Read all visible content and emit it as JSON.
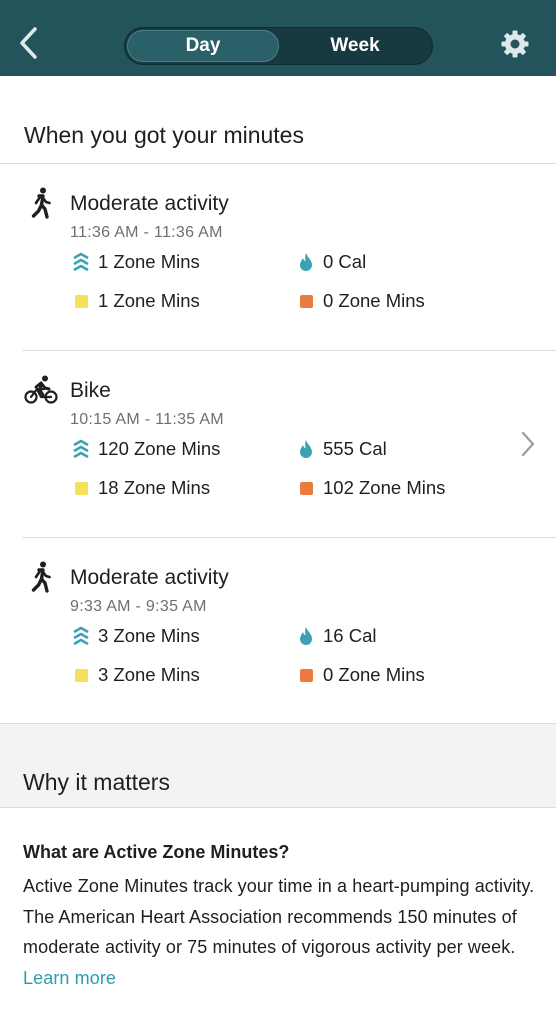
{
  "header": {
    "tabs": [
      {
        "label": "Day",
        "selected": true
      },
      {
        "label": "Week",
        "selected": false
      }
    ],
    "back_icon": "chevron-left-icon",
    "settings_icon": "gear-icon"
  },
  "minutes_section": {
    "title": "When you got your minutes"
  },
  "activities": [
    {
      "icon": "walking-icon",
      "title": "Moderate activity",
      "time": "11:36 AM - 11:36 AM",
      "zone_mins": "1 Zone Mins",
      "calories": "0 Cal",
      "fat_burn_mins": "1 Zone Mins",
      "cardio_mins": "0 Zone Mins"
    },
    {
      "icon": "bike-icon",
      "title": "Bike",
      "time": "10:15 AM - 11:35 AM",
      "zone_mins": "120 Zone Mins",
      "calories": "555 Cal",
      "fat_burn_mins": "18 Zone Mins",
      "cardio_mins": "102 Zone Mins"
    },
    {
      "icon": "walking-icon",
      "title": "Moderate activity",
      "time": "9:33 AM - 9:35 AM",
      "zone_mins": "3 Zone Mins",
      "calories": "16 Cal",
      "fat_burn_mins": "3 Zone Mins",
      "cardio_mins": "0 Zone Mins"
    }
  ],
  "why_section": {
    "title": "Why it matters",
    "question": "What are Active Zone Minutes?",
    "answer": "Active Zone Minutes track your time in a heart-pumping activity. The American Heart Association recommends 150 minutes of moderate activity or 75 minutes of vigorous activity per week.",
    "link": "Learn more"
  },
  "colors": {
    "header_bg": "#23545b",
    "fat_burn": "#f4e05a",
    "cardio": "#ea7a3e",
    "accent": "#2a9eb0"
  }
}
